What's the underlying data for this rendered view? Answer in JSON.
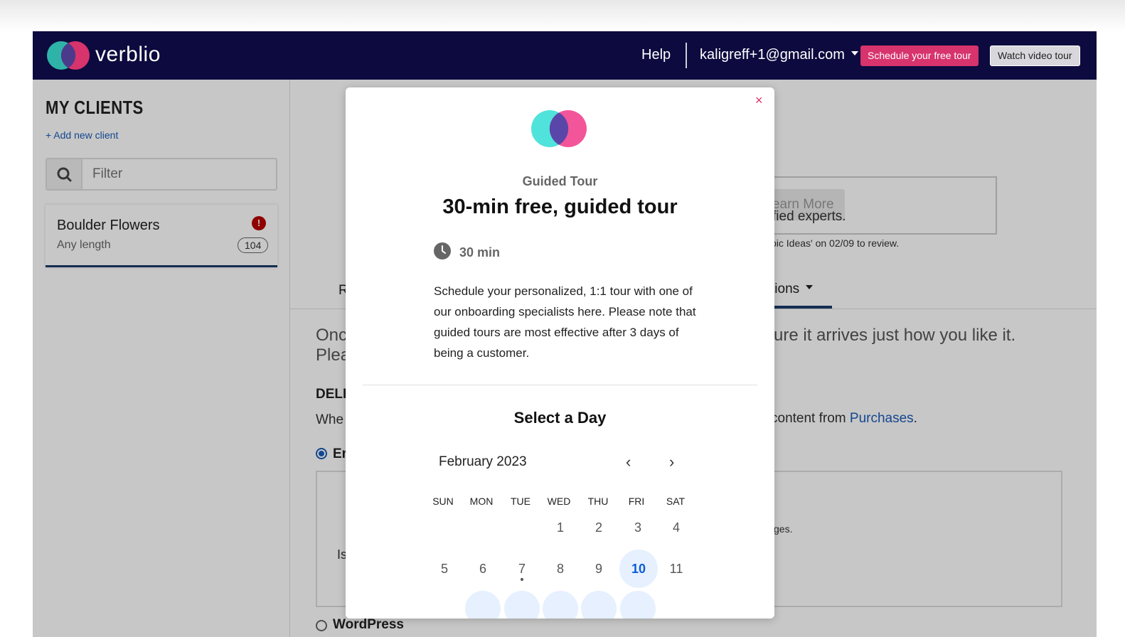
{
  "app": {
    "brand": "verblio",
    "nav": {
      "help": "Help",
      "user_email": "kaligreff+1@gmail.com",
      "schedule_button": "Schedule your free tour",
      "video_button": "Watch video tour"
    }
  },
  "sidebar": {
    "title": "MY CLIENTS",
    "add_client": "+ Add new client",
    "filter_placeholder": "Filter",
    "clients": [
      {
        "name": "Boulder Flowers",
        "length": "Any length",
        "count": "104",
        "alert": "!"
      }
    ]
  },
  "main": {
    "learn_more": "Learn More",
    "experts_fragment": "fied experts.",
    "review_fragment": "pic Ideas' on 02/09 to review.",
    "tab_options": "tions",
    "tab_r": "R",
    "fragments": {
      "onc": "Onc",
      "plea": "Plea",
      "deliv": "DELIV",
      "whe": "Whe",
      "en": "Er",
      "is": "Is",
      "es": "ges."
    },
    "arrives": "ure it arrives just how you like it.",
    "content_from": "content from",
    "purchases_link": "Purchases",
    "wordpress": "WordPress"
  },
  "modal": {
    "close": "×",
    "eyebrow": "Guided Tour",
    "title": "30-min free, guided tour",
    "duration": "30 min",
    "description": "Schedule your personalized, 1:1 tour with one of our onboarding specialists here. Please note that guided tours are most effective after 3 days of being a customer.",
    "select_day": "Select a Day",
    "month": "February 2023",
    "prev": "‹",
    "next": "›",
    "weekdays": [
      "SUN",
      "MON",
      "TUE",
      "WED",
      "THU",
      "FRI",
      "SAT"
    ],
    "row1": [
      "1",
      "2",
      "3",
      "4"
    ],
    "row2": [
      "5",
      "6",
      "7",
      "8",
      "9",
      "10",
      "11"
    ],
    "selected_day": "10",
    "colors": {
      "accent": "#d7336c",
      "selected": "#0b5cd6",
      "navbar": "#0c0a3e"
    }
  }
}
